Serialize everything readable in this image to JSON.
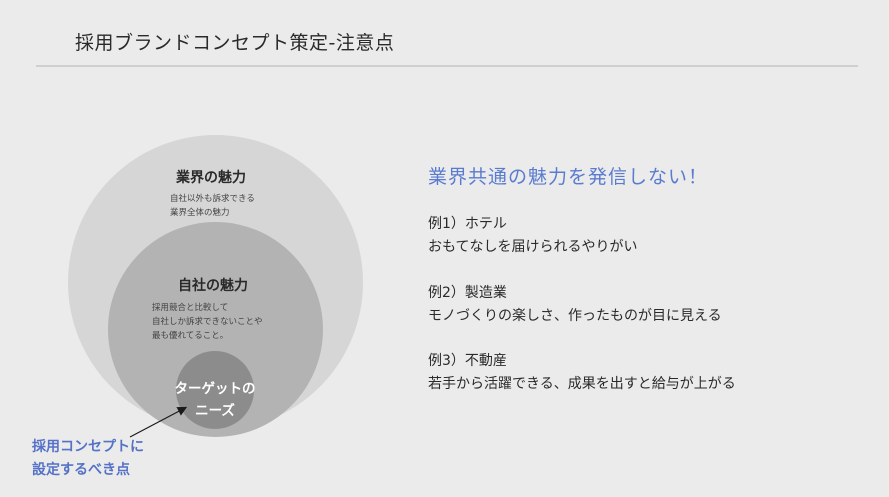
{
  "page": {
    "title": "採用ブランドコンセプト策定-注意点"
  },
  "diagram": {
    "outer": {
      "label": "業界の魅力",
      "desc": [
        "自社以外も訴求できる",
        "業界全体の魅力"
      ]
    },
    "middle": {
      "label": "自社の魅力",
      "desc": [
        "採用競合と比較して",
        "自社しか訴求できないことや",
        "最も優れてること。"
      ]
    },
    "inner": {
      "label": [
        "ターゲットの",
        "ニーズ"
      ]
    },
    "note": [
      "採用コンセプトに",
      "設定するべき点"
    ]
  },
  "right": {
    "headline": "業界共通の魅力を発信しない！",
    "examples": [
      {
        "title": "例1）ホテル",
        "text": "おもてなしを届けられるやりがい"
      },
      {
        "title": "例2）製造業",
        "text": "モノづくりの楽しさ、作ったものが目に見える"
      },
      {
        "title": "例3）不動産",
        "text": "若手から活躍できる、成果を出すと給与が上がる"
      }
    ]
  },
  "colors": {
    "accent": "#5a7bd0",
    "note": "#5572c7",
    "outer_circle": "#d6d6d6",
    "middle_circle": "#b3b3b3",
    "inner_circle": "#8c8c8c",
    "background": "#ebebeb"
  }
}
